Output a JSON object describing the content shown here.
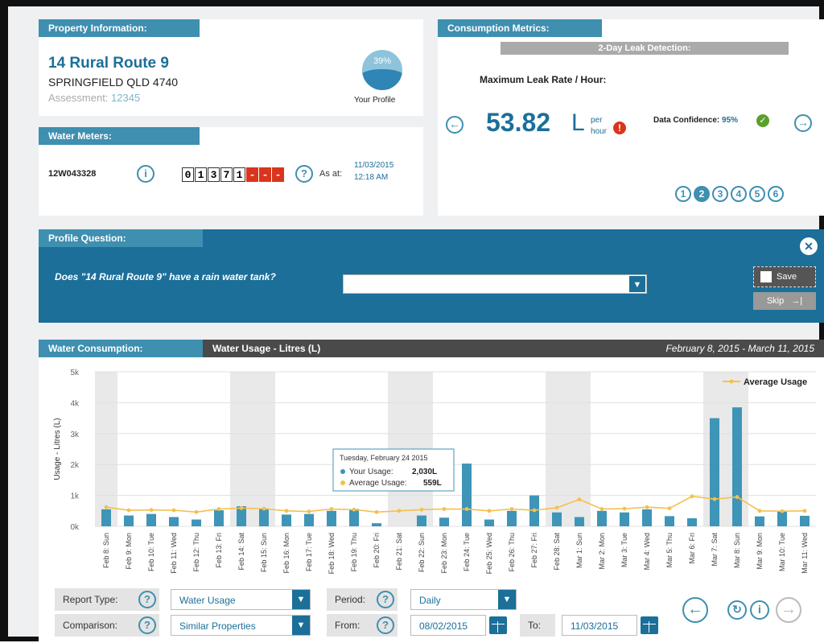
{
  "property": {
    "title": "Property Information:",
    "address1": "14 Rural Route 9",
    "address2": "SPRINGFIELD QLD 4740",
    "assessment_label": "Assessment:",
    "assessment_value": "12345",
    "profile_percent": "39%",
    "profile_label": "Your Profile"
  },
  "meter": {
    "title": "Water Meters:",
    "id": "12W043328",
    "info_icon": "i",
    "digits": [
      "0",
      "1",
      "3",
      "7",
      "1"
    ],
    "red_digits": [
      "-",
      "-",
      "-"
    ],
    "help_icon": "?",
    "as_at_label": "As at:",
    "date": "11/03/2015",
    "time": "12:18 AM"
  },
  "metrics": {
    "title": "Consumption Metrics:",
    "subtitle": "2-Day Leak Detection:",
    "heading": "Maximum Leak Rate / Hour:",
    "value": "53.82",
    "unit": "L",
    "unit_per": "per",
    "unit_hour": "hour",
    "confidence_label": "Data Confidence:",
    "confidence_value": "95%",
    "pages": [
      "1",
      "2",
      "3",
      "4",
      "5",
      "6"
    ],
    "active_page": "2"
  },
  "profile_question": {
    "title": "Profile Question:",
    "question": "Does \"14 Rural Route 9\" have a rain water tank?",
    "selected": "",
    "save_label": "Save",
    "skip_label": "Skip"
  },
  "consumption": {
    "title": "Water Consumption:",
    "chart_title": "Water Usage - Litres (L)",
    "date_range": "February 8, 2015 - March 11, 2015"
  },
  "chart_data": {
    "type": "bar",
    "title": "Water Usage - Litres (L)",
    "ylabel": "Usage - Litres (L)",
    "ylim": [
      0,
      5000
    ],
    "yticks": [
      "0k",
      "1k",
      "2k",
      "3k",
      "4k",
      "5k"
    ],
    "legend": "Average Usage",
    "legend_position": "top-right",
    "categories": [
      "Feb 8: Sun",
      "Feb 9: Mon",
      "Feb 10: Tue",
      "Feb 11: Wed",
      "Feb 12: Thu",
      "Feb 13: Fri",
      "Feb 14: Sat",
      "Feb 15: Sun",
      "Feb 16: Mon",
      "Feb 17: Tue",
      "Feb 18: Wed",
      "Feb 19: Thu",
      "Feb 20: Fri",
      "Feb 21: Sat",
      "Feb 22: Sun",
      "Feb 23: Mon",
      "Feb 24: Tue",
      "Feb 25: Wed",
      "Feb 26: Thu",
      "Feb 27: Fri",
      "Feb 28: Sat",
      "Mar 1: Sun",
      "Mar 2: Mon",
      "Mar 3: Tue",
      "Mar 4: Wed",
      "Mar 5: Thu",
      "Mar 6: Fri",
      "Mar 7: Sat",
      "Mar 8: Sun",
      "Mar 9: Mon",
      "Mar 10: Tue",
      "Mar 11: Wed"
    ],
    "series": [
      {
        "name": "Your Usage",
        "color": "#3e95b8",
        "values": [
          550,
          350,
          400,
          300,
          220,
          520,
          650,
          580,
          380,
          400,
          500,
          560,
          100,
          0,
          350,
          280,
          2030,
          220,
          500,
          1000,
          450,
          300,
          500,
          450,
          550,
          330,
          260,
          3500,
          3850,
          320,
          480,
          340
        ]
      },
      {
        "name": "Average Usage",
        "color": "#f5c04d",
        "values": [
          620,
          520,
          530,
          520,
          460,
          560,
          590,
          570,
          500,
          480,
          560,
          540,
          460,
          500,
          540,
          560,
          559,
          500,
          560,
          520,
          600,
          870,
          560,
          570,
          620,
          580,
          970,
          880,
          950,
          500,
          490,
          500
        ]
      }
    ],
    "weekend_indices": [
      0,
      6,
      7,
      13,
      14,
      20,
      21,
      27,
      28
    ],
    "tooltip": {
      "date": "Tuesday, February 24 2015",
      "your_label": "Your Usage:",
      "your_value": "2,030L",
      "avg_label": "Average Usage:",
      "avg_value": "559L"
    }
  },
  "controls": {
    "report_type_label": "Report Type:",
    "report_type_value": "Water Usage",
    "comparison_label": "Comparison:",
    "comparison_value": "Similar Properties",
    "period_label": "Period:",
    "period_value": "Daily",
    "from_label": "From:",
    "from_value": "08/02/2015",
    "to_label": "To:",
    "to_value": "11/03/2015"
  }
}
